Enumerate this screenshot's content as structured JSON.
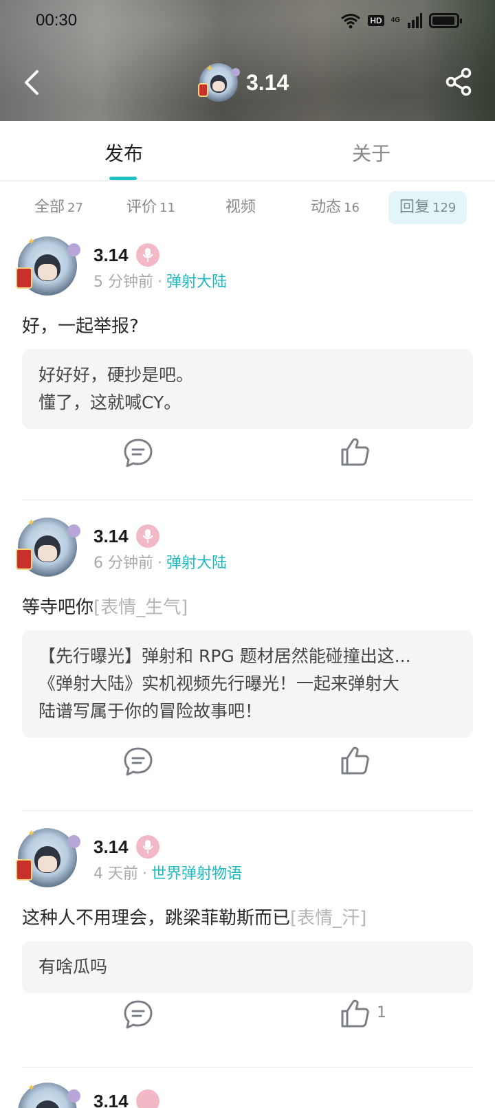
{
  "status_bar": {
    "time": "00:30",
    "network": "4G",
    "hd": "HD"
  },
  "header": {
    "title": "3.14",
    "back_icon": "chevron-left-icon",
    "share_icon": "share-icon"
  },
  "tabs": [
    {
      "label": "发布",
      "active": true
    },
    {
      "label": "关于",
      "active": false
    }
  ],
  "filters": [
    {
      "label": "全部",
      "count": "27",
      "active": false
    },
    {
      "label": "评价",
      "count": "11",
      "active": false
    },
    {
      "label": "视频",
      "count": "",
      "active": false
    },
    {
      "label": "动态",
      "count": "16",
      "active": false
    },
    {
      "label": "回复",
      "count": "129",
      "active": true
    }
  ],
  "colors": {
    "accent": "#1ec0c6",
    "game_link": "#1cb8c0",
    "mic_badge": "#f2b8c6"
  },
  "posts": [
    {
      "username": "3.14",
      "time": "5 分钟前",
      "separator": "·",
      "game": "弹射大陆",
      "text": "好，一起举报?",
      "emoji": "",
      "quote_lines": [
        "好好好，硬抄是吧。",
        "懂了，这就喊CY。"
      ],
      "likes": ""
    },
    {
      "username": "3.14",
      "time": "6 分钟前",
      "separator": "·",
      "game": "弹射大陆",
      "text": "等寺吧你",
      "emoji": "[表情_生气]",
      "quote_lines": [
        "【先行曝光】弹射和 RPG 题材居然能碰撞出这...",
        "《弹射大陆》实机视频先行曝光！一起来弹射大",
        "陆谱写属于你的冒险故事吧！"
      ],
      "likes": ""
    },
    {
      "username": "3.14",
      "time": "4 天前",
      "separator": "·",
      "game": "世界弹射物语",
      "text": "这种人不用理会，跳梁菲勒斯而已",
      "emoji": "[表情_汗]",
      "quote_lines": [
        "有啥瓜吗"
      ],
      "likes": "1"
    },
    {
      "username": "3.14"
    }
  ]
}
